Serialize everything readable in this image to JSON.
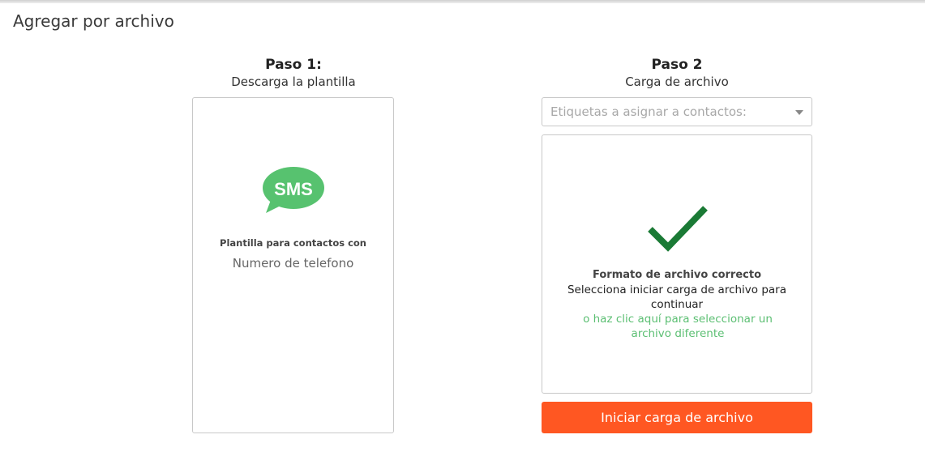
{
  "page": {
    "title": "Agregar por archivo"
  },
  "step1": {
    "number": "Paso 1:",
    "subtitle": "Descarga la plantilla",
    "card": {
      "logo_text": "SMS",
      "title": "Plantilla para contactos con",
      "subtitle": "Numero de telefono"
    }
  },
  "step2": {
    "number": "Paso 2",
    "subtitle": "Carga de archivo",
    "tags_select": {
      "placeholder": "Etiquetas a asignar a contactos:"
    },
    "upload": {
      "status": "Formato de archivo correcto",
      "instruction": "Selecciona iniciar carga de archivo para continuar",
      "change_link": "o haz clic aquí para seleccionar un archivo diferente"
    },
    "start_button": "Iniciar carga de archivo"
  },
  "colors": {
    "accent_orange": "#ff5722",
    "sms_green": "#57c26f",
    "check_green": "#1a7a35",
    "link_green": "#5cbf73"
  },
  "icons": {
    "sms": "sms-bubble-icon",
    "check": "checkmark-icon",
    "caret": "caret-down-icon"
  }
}
